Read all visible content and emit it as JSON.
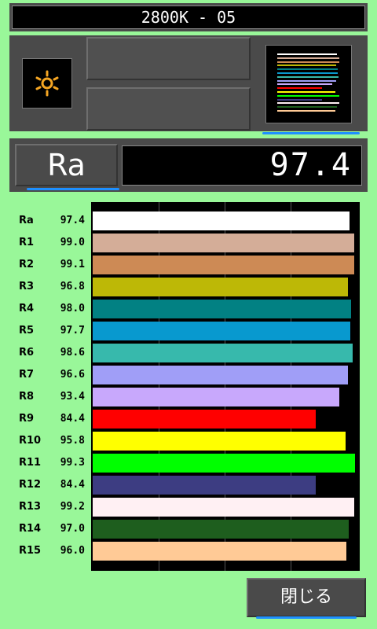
{
  "header": {
    "title": "2800K - 05"
  },
  "icons": {
    "light": "sun-icon",
    "chart": "bar-chart-thumbnail-icon"
  },
  "ra": {
    "label": "Ra",
    "value": "97.4"
  },
  "actions": {
    "close_label": "閉じる"
  },
  "colors": {
    "background": "#99f799",
    "accent": "#1e90ff",
    "panel": "#4a4a4a"
  },
  "chart_data": {
    "type": "bar",
    "orientation": "horizontal",
    "categories": [
      "Ra",
      "R1",
      "R2",
      "R3",
      "R4",
      "R5",
      "R6",
      "R7",
      "R8",
      "R9",
      "R10",
      "R11",
      "R12",
      "R13",
      "R14",
      "R15"
    ],
    "values": [
      97.4,
      99.0,
      99.1,
      96.8,
      98.0,
      97.7,
      98.6,
      96.6,
      93.4,
      84.4,
      95.8,
      99.3,
      84.4,
      99.2,
      97.0,
      96.0
    ],
    "value_labels": [
      "97.4",
      "99.0",
      "99.1",
      "96.8",
      "98.0",
      "97.7",
      "98.6",
      "96.6",
      "93.4",
      "84.4",
      "95.8",
      "99.3",
      "84.4",
      "99.2",
      "97.0",
      "96.0"
    ],
    "bar_colors": [
      "#ffffff",
      "#d4ad98",
      "#cd8a55",
      "#bdb806",
      "#028183",
      "#0899cf",
      "#37b9ac",
      "#a09ef7",
      "#c8a8fc",
      "#ff0000",
      "#ffff00",
      "#00ff00",
      "#3d3d82",
      "#fff0f3",
      "#1e5e1e",
      "#ffca96"
    ],
    "xlim": [
      0,
      100
    ],
    "grid": true
  }
}
